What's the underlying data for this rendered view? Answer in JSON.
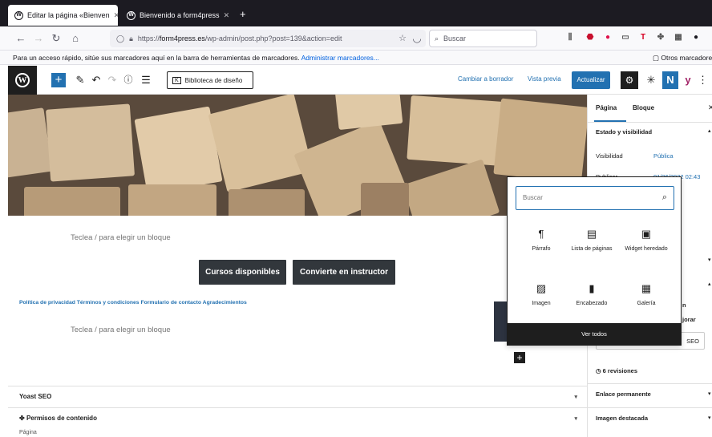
{
  "browser": {
    "tabs": [
      {
        "label": "Editar la página «Bienven",
        "active": true
      },
      {
        "label": "Bienvenido a form4press",
        "active": false
      }
    ],
    "new_tab": "+",
    "url_prefix": "https://",
    "url_domain": "form4press.es",
    "url_path": "/wp-admin/post.php?post=139&action=edit",
    "search_placeholder": "Buscar",
    "bookmarks_text": "Para un acceso rápido, sitúe sus marcadores aquí en la barra de herramientas de marcadores.",
    "bookmarks_link": "Administrar marcadores...",
    "other_bookmarks": "Otros marcadores"
  },
  "toolbar": {
    "library_button": "Biblioteca de diseño",
    "switch_draft": "Cambiar a borrador",
    "preview": "Vista previa",
    "update": "Actualizar"
  },
  "editor": {
    "placeholder_1": "Teclea / para elegir un bloque",
    "button_1": "Cursos disponibles",
    "button_2": "Convierte en instructor",
    "footer_links": [
      "Política de privacidad",
      "Términos y condiciones",
      "Formulario de contacto",
      "Agradecimientos"
    ],
    "placeholder_2": "Teclea / para elegir un bloque"
  },
  "inserter": {
    "search_placeholder": "Buscar",
    "blocks": [
      {
        "label": "Párrafo",
        "icon": "paragraph-icon",
        "glyph": "¶"
      },
      {
        "label": "Lista de páginas",
        "icon": "page-list-icon",
        "glyph": "▤"
      },
      {
        "label": "Widget heredado",
        "icon": "widget-icon",
        "glyph": "▣"
      },
      {
        "label": "Imagen",
        "icon": "image-icon",
        "glyph": "▨"
      },
      {
        "label": "Encabezado",
        "icon": "heading-icon",
        "glyph": "▮"
      },
      {
        "label": "Galería",
        "icon": "gallery-icon",
        "glyph": "▦"
      }
    ],
    "browse_all": "Ver todos"
  },
  "sidebar": {
    "tab_page": "Página",
    "tab_block": "Bloque",
    "status_heading": "Estado y visibilidad",
    "visibility_label": "Visibilidad",
    "visibility_value": "Pública",
    "publish_label": "Publicar",
    "publish_value": "01/26/2022 02:43",
    "partial_1": "n",
    "partial_2": "jorar",
    "seo_button": "SEO",
    "revisions": "6 revisiones",
    "permalink": "Enlace permanente",
    "featured_image": "Imagen destacada"
  },
  "metaboxes": {
    "yoast": "Yoast SEO",
    "permissions": "Permisos de contenido",
    "page_label": "Página"
  },
  "colors": {
    "accent": "#2271b1",
    "dark": "#1e1e1e"
  }
}
